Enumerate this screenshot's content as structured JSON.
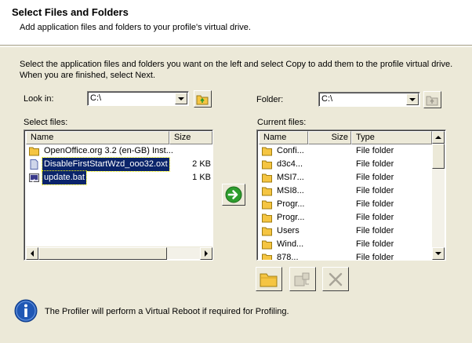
{
  "header": {
    "title": "Select Files and Folders",
    "subtitle": "Add application files and folders to your profile's virtual drive."
  },
  "instructions": "Select the application files and folders you want on the left and select Copy to add them to the profile virtual drive. When you are finished, select Next.",
  "left": {
    "look_in_label": "Look in:",
    "look_in_value": "C:\\",
    "select_files_label": "Select files:",
    "columns": {
      "name": "Name",
      "size": "Size"
    },
    "rows": [
      {
        "name": "OpenOffice.org 3.2 (en-GB) Inst...",
        "size": "",
        "icon": "folder-icon",
        "selected": false
      },
      {
        "name": "DisableFirstStartWzd_ooo32.oxt",
        "size": "2 KB",
        "icon": "file-icon",
        "selected": true
      },
      {
        "name": "update.bat",
        "size": "1 KB",
        "icon": "batch-file-icon",
        "selected": true
      }
    ]
  },
  "right": {
    "folder_label": "Folder:",
    "folder_value": "C:\\",
    "current_files_label": "Current files:",
    "columns": {
      "name": "Name",
      "size": "Size",
      "type": "Type"
    },
    "rows": [
      {
        "name": "Confi...",
        "size": "",
        "type": "File folder"
      },
      {
        "name": "d3c4...",
        "size": "",
        "type": "File folder"
      },
      {
        "name": "MSI7...",
        "size": "",
        "type": "File folder"
      },
      {
        "name": "MSI8...",
        "size": "",
        "type": "File folder"
      },
      {
        "name": "Progr...",
        "size": "",
        "type": "File folder"
      },
      {
        "name": "Progr...",
        "size": "",
        "type": "File folder"
      },
      {
        "name": "Users",
        "size": "",
        "type": "File folder"
      },
      {
        "name": "Wind...",
        "size": "",
        "type": "File folder"
      },
      {
        "name": "878...",
        "size": "",
        "type": "File folder"
      }
    ]
  },
  "info_text": "The Profiler will perform a Virtual Reboot if required for Profiling.",
  "colors": {
    "dialog_bg": "#ece9d8",
    "selection": "#0a246a",
    "folder_yellow": "#f5c542",
    "copy_green": "#2e9d2e",
    "info_blue": "#1f57b5"
  }
}
